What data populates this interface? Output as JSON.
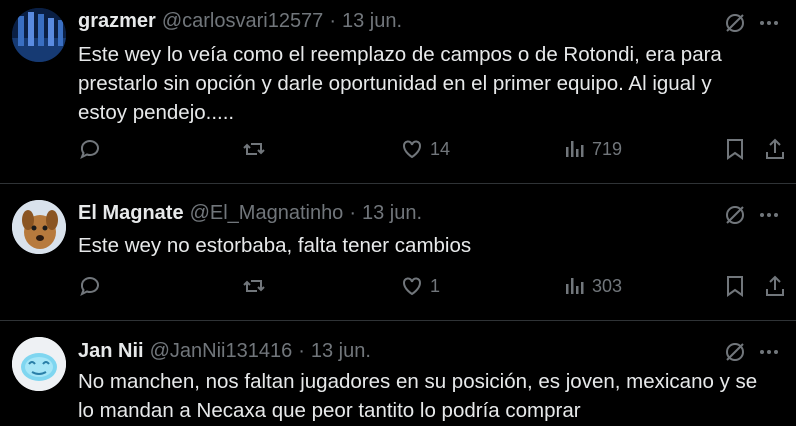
{
  "tweets": [
    {
      "name": "grazmer",
      "handle": "@carlosvari12577",
      "separator": "·",
      "date": "13 jun.",
      "text_lines": [
        "Este wey lo veía como el reemplazo de campos o de Rotondi, era para",
        "prestarlo sin opción y darle oportunidad en el primer equipo. Al igual y",
        "estoy pendejo....."
      ],
      "likes": "14",
      "views": "719",
      "avatar": "stadium-avatar"
    },
    {
      "name": "El Magnate",
      "handle": "@El_Magnatinho",
      "separator": "·",
      "date": "13 jun.",
      "text_lines": [
        "Este wey no estorbaba, falta tener cambios"
      ],
      "likes": "1",
      "views": "303",
      "avatar": "dog-avatar"
    },
    {
      "name": "Jan Nii",
      "handle": "@JanNii131416",
      "separator": "·",
      "date": "13 jun.",
      "text_lines": [
        "No manchen, nos faltan jugadores en su posición, es joven, mexicano y se",
        "lo mandan a Necaxa que peor tantito lo podría comprar"
      ],
      "avatar": "blue-face-avatar"
    }
  ],
  "icons": [
    "reply-icon",
    "retweet-icon",
    "like-icon",
    "views-icon",
    "bookmark-icon",
    "share-icon",
    "grok-icon",
    "more-icon"
  ],
  "colors": {
    "background": "#000000",
    "text": "#e7e9ea",
    "muted": "#71767b",
    "divider": "#2f3336"
  }
}
